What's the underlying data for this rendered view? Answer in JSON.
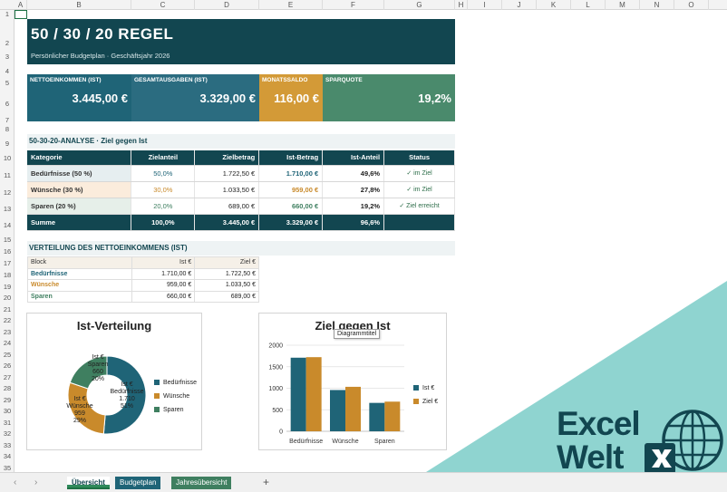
{
  "columns": [
    "A",
    "B",
    "C",
    "D",
    "E",
    "F",
    "G",
    "H",
    "I",
    "J",
    "K",
    "L",
    "M",
    "N",
    "O"
  ],
  "rows": [
    "1",
    "2",
    "3",
    "4",
    "5",
    "6",
    "7",
    "8",
    "9",
    "10",
    "11",
    "12",
    "13",
    "14",
    "15",
    "16",
    "17",
    "18",
    "19",
    "20",
    "21",
    "22",
    "23",
    "24",
    "25",
    "26",
    "27",
    "28",
    "29",
    "30",
    "31",
    "32",
    "33",
    "34",
    "35"
  ],
  "header": {
    "title": "50 / 30 / 20  REGEL",
    "subtitle": "Persönlicher Budgetplan  ·  Geschäftsjahr 2026"
  },
  "kpis": [
    {
      "label": "NETTOEINKOMMEN (IST)",
      "value": "3.445,00 €",
      "color": "#1f6477"
    },
    {
      "label": "GESAMTAUSGABEN (IST)",
      "value": "3.329,00 €",
      "color": "#2b6c80"
    },
    {
      "label": "MONATSSALDO",
      "value": "116,00 €",
      "color": "#d39a37"
    },
    {
      "label": "SPARQUOTE",
      "value": "19,2%",
      "color": "#4a8a6c"
    }
  ],
  "analysis": {
    "title": "50-30-20-ANALYSE  ·  Ziel gegen Ist",
    "headers": [
      "Kategorie",
      "Zielanteil",
      "Zielbetrag",
      "Ist-Betrag",
      "Ist-Anteil",
      "Status"
    ],
    "rows": [
      {
        "kategorie": "Bedürfnisse (50 %)",
        "ziel": "50,0%",
        "zielbetrag": "1.722,50 €",
        "ist": "1.710,00 €",
        "anteil": "49,6%",
        "status": "✓ im Ziel",
        "bg": "#e6eef0",
        "accent": "#1f6477"
      },
      {
        "kategorie": "Wünsche (30 %)",
        "ziel": "30,0%",
        "zielbetrag": "1.033,50 €",
        "ist": "959,00 €",
        "anteil": "27,8%",
        "status": "✓ im Ziel",
        "bg": "#fbecdc",
        "accent": "#c98a2b"
      },
      {
        "kategorie": "Sparen (20 %)",
        "ziel": "20,0%",
        "zielbetrag": "689,00 €",
        "ist": "660,00 €",
        "anteil": "19,2%",
        "status": "✓ Ziel erreicht",
        "bg": "#e6efe9",
        "accent": "#3f7f60"
      }
    ],
    "sum": {
      "kategorie": "Summe",
      "ziel": "100,0%",
      "zielbetrag": "3.445,00 €",
      "ist": "3.329,00 €",
      "anteil": "96,6%",
      "status": ""
    }
  },
  "distribution": {
    "title": "VERTEILUNG DES NETTOEINKOMMENS (IST)",
    "headers": [
      "Block",
      "Ist €",
      "Ziel €"
    ],
    "rows": [
      {
        "block": "Bedürfnisse",
        "ist": "1.710,00 €",
        "ziel": "1.722,50 €",
        "color": "#1f6477"
      },
      {
        "block": "Wünsche",
        "ist": "959,00 €",
        "ziel": "1.033,50 €",
        "color": "#c98a2b"
      },
      {
        "block": "Sparen",
        "ist": "660,00 €",
        "ziel": "689,00 €",
        "color": "#3f7f60"
      }
    ]
  },
  "chart_data": [
    {
      "type": "pie",
      "title": "Ist-Verteilung",
      "categories": [
        "Bedürfnisse",
        "Wünsche",
        "Sparen"
      ],
      "values": [
        1710,
        959,
        660
      ],
      "percent_labels": [
        "51%",
        "29%",
        "20%"
      ],
      "data_labels": [
        "Ist €; Bedürfnisse; 1.710; 51%",
        "Ist €; Wünsche; 959; 29%",
        "Ist €; Sparen; 660; 20%"
      ],
      "colors": [
        "#1f6477",
        "#c98a2b",
        "#3f7f60"
      ],
      "legend": "right"
    },
    {
      "type": "bar",
      "title": "Ziel gegen Ist",
      "tooltip": "Diagrammtitel",
      "categories": [
        "Bedürfnisse",
        "Wünsche",
        "Sparen"
      ],
      "series": [
        {
          "name": "Ist €",
          "values": [
            1710,
            959,
            660
          ],
          "color": "#1f6477"
        },
        {
          "name": "Ziel €",
          "values": [
            1722.5,
            1033.5,
            689
          ],
          "color": "#c98a2b"
        }
      ],
      "ylim": [
        0,
        2000
      ],
      "yticks": [
        "0",
        "500",
        "1000",
        "1500",
        "2000"
      ],
      "legend": "right"
    }
  ],
  "sheet_tabs": [
    {
      "label": "Übersicht",
      "active": true
    },
    {
      "label": "Budgetplan",
      "active": false
    },
    {
      "label": "Jahresübersicht",
      "active": false
    }
  ],
  "add_sheet": "+",
  "watermark": {
    "line1": "Excel",
    "line2": "Welt"
  }
}
